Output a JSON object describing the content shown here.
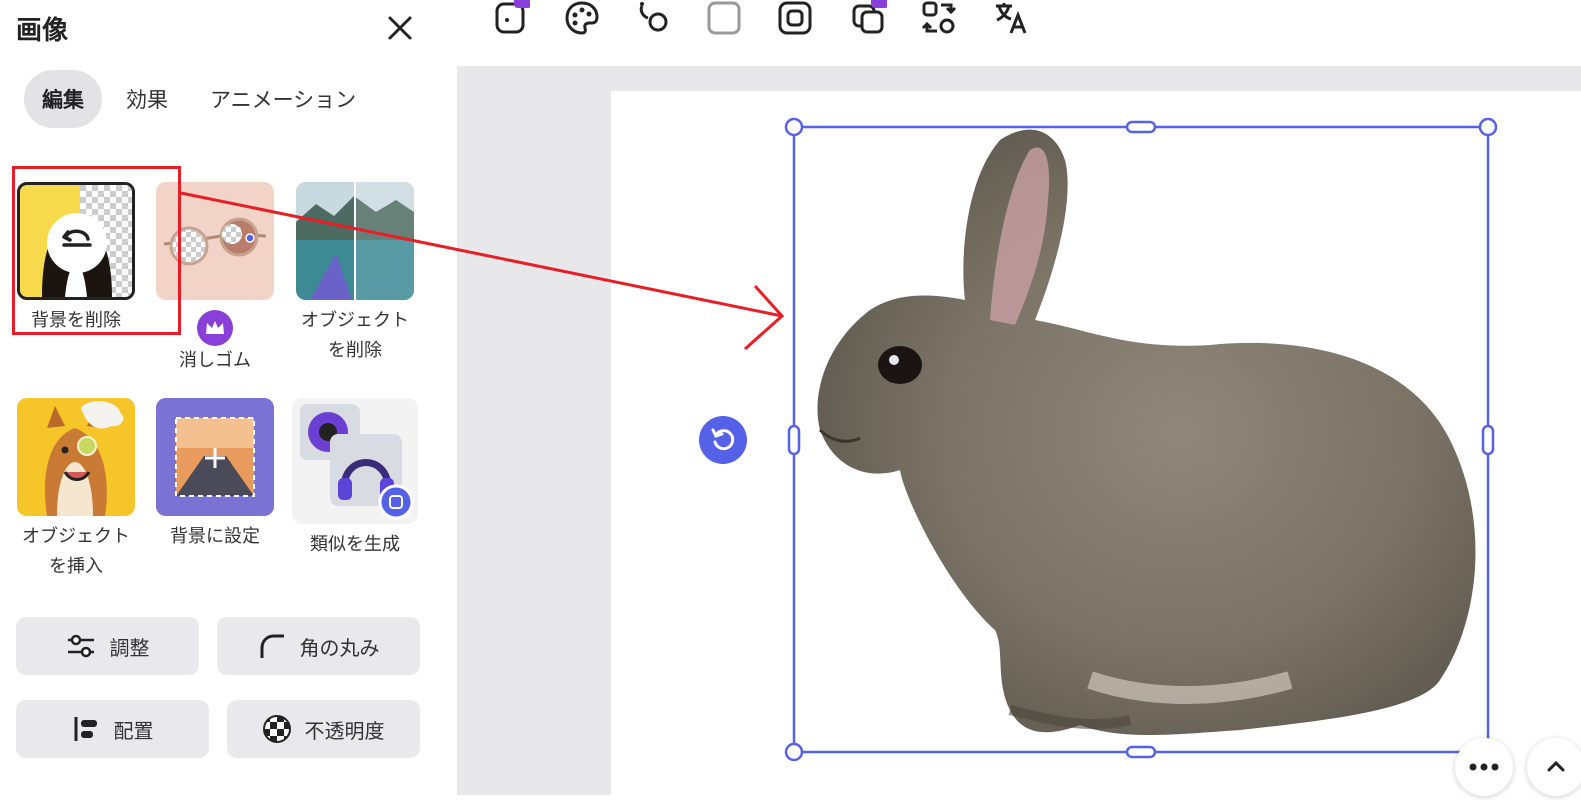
{
  "panel": {
    "title": "画像",
    "tabs": [
      {
        "label": "編集"
      },
      {
        "label": "効果"
      },
      {
        "label": "アニメーション"
      }
    ],
    "tools": [
      {
        "label": "背景を削除"
      },
      {
        "label": "消しゴム"
      },
      {
        "label": "オブジェクト\nを削除"
      },
      {
        "label": "オブジェクト\nを挿入"
      },
      {
        "label": "背景に設定"
      },
      {
        "label": "類似を生成"
      }
    ],
    "buttons": {
      "adjust": "調整",
      "corner": "角の丸み",
      "position": "配置",
      "opacity": "不透明度"
    }
  },
  "colors": {
    "accent": "#5561e6",
    "highlight": "#e81e26",
    "premium": "#8b3fd9"
  },
  "icons": [
    "close-icon",
    "rotate-icon",
    "crown-icon",
    "adjust-icon",
    "corner-icon",
    "align-icon",
    "opacity-icon",
    "more-icon",
    "chevron-up-icon"
  ]
}
